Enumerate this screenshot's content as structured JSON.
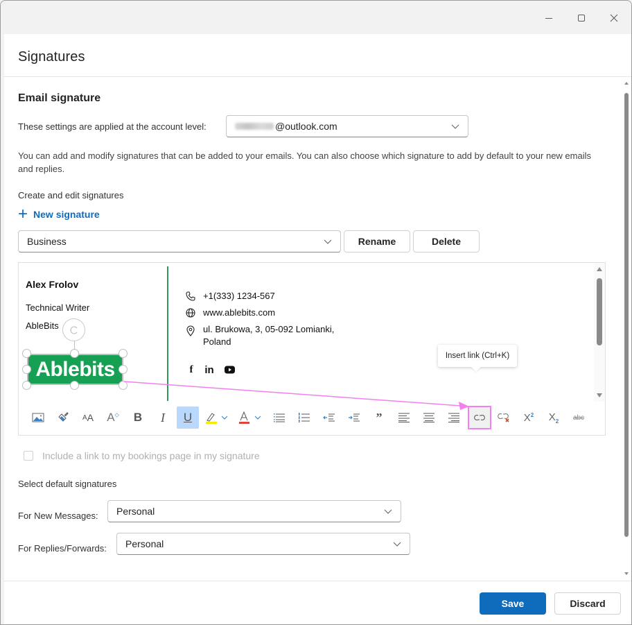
{
  "window": {
    "controls": {
      "minimize": "–",
      "maximize": "☐",
      "close": "✕"
    }
  },
  "panel": {
    "title": "Signatures"
  },
  "email_signature": {
    "heading": "Email signature",
    "account_label": "These settings are applied at the account level:",
    "account_value": "@outlook.com",
    "description": "You can add and modify signatures that can be added to your emails. You can also choose which signature to add by default to your new emails and replies.",
    "create_label": "Create and edit signatures",
    "new_signature": "New signature",
    "signature_select": "Business",
    "rename": "Rename",
    "delete": "Delete"
  },
  "signature_content": {
    "name": "Alex Frolov",
    "role": "Technical Writer",
    "company": "AbleBits",
    "logo_text": "Ablebits",
    "phone": "+1(333) 1234-567",
    "website": "www.ablebits.com",
    "address_line1": "ul. Brukowa, 3, 05-092 Lomianki,",
    "address_line2": "Poland",
    "social": [
      "f",
      "in",
      "yt"
    ]
  },
  "toolbar": {
    "items": [
      {
        "name": "insert-picture",
        "icon": "image-icon"
      },
      {
        "name": "format-painter",
        "icon": "paintbrush-icon"
      },
      {
        "name": "font-size",
        "icon": "font-size-icon",
        "glyph": "ᴬA"
      },
      {
        "name": "text-effects",
        "icon": "text-case-icon",
        "glyph": "A"
      },
      {
        "name": "bold",
        "icon": "bold-icon",
        "glyph": "B"
      },
      {
        "name": "italic",
        "icon": "italic-icon",
        "glyph": "I"
      },
      {
        "name": "underline",
        "icon": "underline-icon",
        "glyph": "U",
        "active": true
      },
      {
        "name": "highlight",
        "icon": "highlighter-icon"
      },
      {
        "name": "font-color",
        "icon": "font-color-icon",
        "glyph": "A"
      },
      {
        "name": "bullets",
        "icon": "bullet-list-icon"
      },
      {
        "name": "numbering",
        "icon": "numbered-list-icon"
      },
      {
        "name": "decrease-indent",
        "icon": "outdent-icon"
      },
      {
        "name": "increase-indent",
        "icon": "indent-icon"
      },
      {
        "name": "quote",
        "icon": "quote-icon",
        "glyph": "„"
      },
      {
        "name": "align-left",
        "icon": "align-left-icon"
      },
      {
        "name": "align-center",
        "icon": "align-center-icon"
      },
      {
        "name": "align-right",
        "icon": "align-right-icon"
      },
      {
        "name": "insert-link",
        "icon": "link-icon"
      },
      {
        "name": "remove-link",
        "icon": "unlink-icon"
      },
      {
        "name": "superscript",
        "icon": "superscript-icon",
        "glyph": "X"
      },
      {
        "name": "subscript",
        "icon": "subscript-icon",
        "glyph": "X"
      },
      {
        "name": "strikethrough",
        "icon": "strikethrough-icon",
        "glyph": "abc"
      }
    ],
    "tooltip": "Insert link (Ctrl+K)",
    "highlight_color": "#f5ea00",
    "font_color": "#e0433b",
    "annotation_color": "#f37ff0"
  },
  "bookings": {
    "label": "Include a link to my bookings page in my signature",
    "checked": false
  },
  "defaults": {
    "heading": "Select default signatures",
    "new_messages_label": "For New Messages:",
    "new_messages_value": "Personal",
    "replies_label": "For Replies/Forwards:",
    "replies_value": "Personal"
  },
  "footer": {
    "save": "Save",
    "discard": "Discard"
  },
  "colors": {
    "accent": "#0f6cbd",
    "logo_green": "#15a054",
    "divider_green": "#2e9a52"
  }
}
